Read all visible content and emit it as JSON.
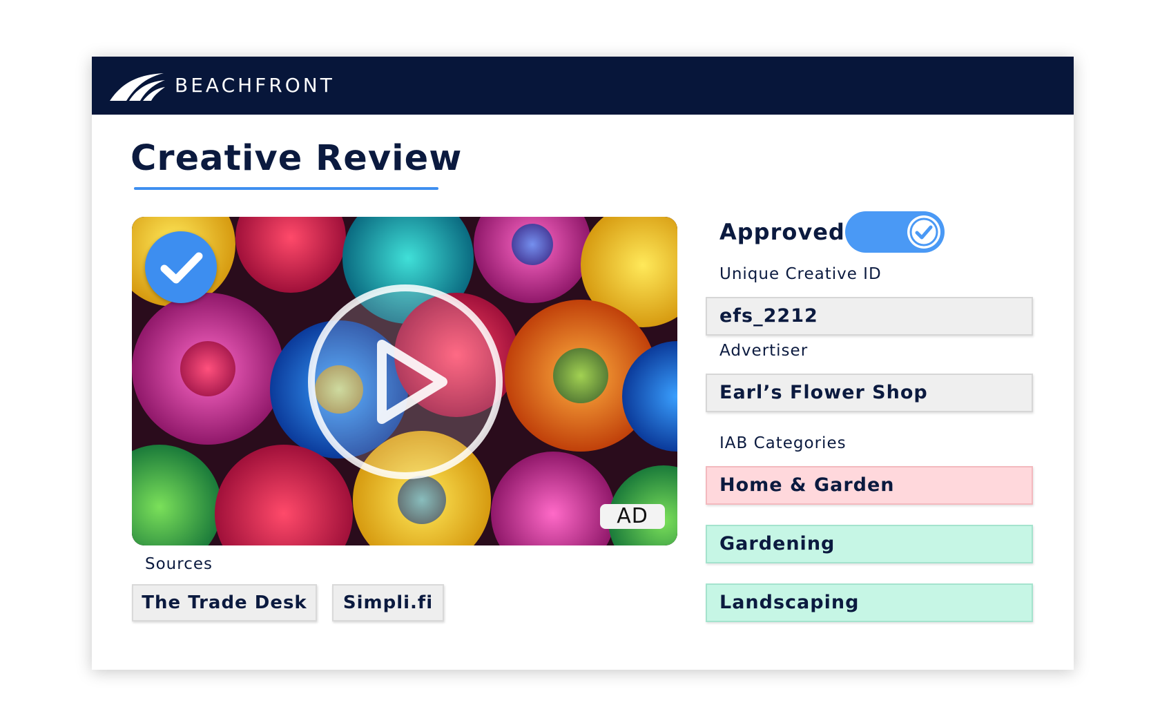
{
  "header": {
    "brand": "BEACHFRONT",
    "logo_icon": "beachfront-wave-logo",
    "background": "#07163a"
  },
  "page": {
    "title": "Creative Review",
    "accent": "#3e8ff0"
  },
  "media": {
    "ad_tag": "AD",
    "approved_badge_icon": "check-icon",
    "play_icon": "play-icon"
  },
  "sources": {
    "label": "Sources",
    "items": [
      "The Trade Desk",
      "Simpli.fi"
    ]
  },
  "approval": {
    "label": "Approved",
    "toggle_on": true,
    "toggle_color": "#4a99f5"
  },
  "fields": {
    "creative_id_label": "Unique Creative ID",
    "creative_id_value": "efs_2212",
    "advertiser_label": "Advertiser",
    "advertiser_value": "Earl’s Flower Shop"
  },
  "iab": {
    "label": "IAB Categories",
    "categories": [
      {
        "name": "Home & Garden",
        "color": "#ffd8dc"
      },
      {
        "name": "Gardening",
        "color": "#c6f6e5"
      },
      {
        "name": "Landscaping",
        "color": "#c6f6e5"
      }
    ]
  }
}
